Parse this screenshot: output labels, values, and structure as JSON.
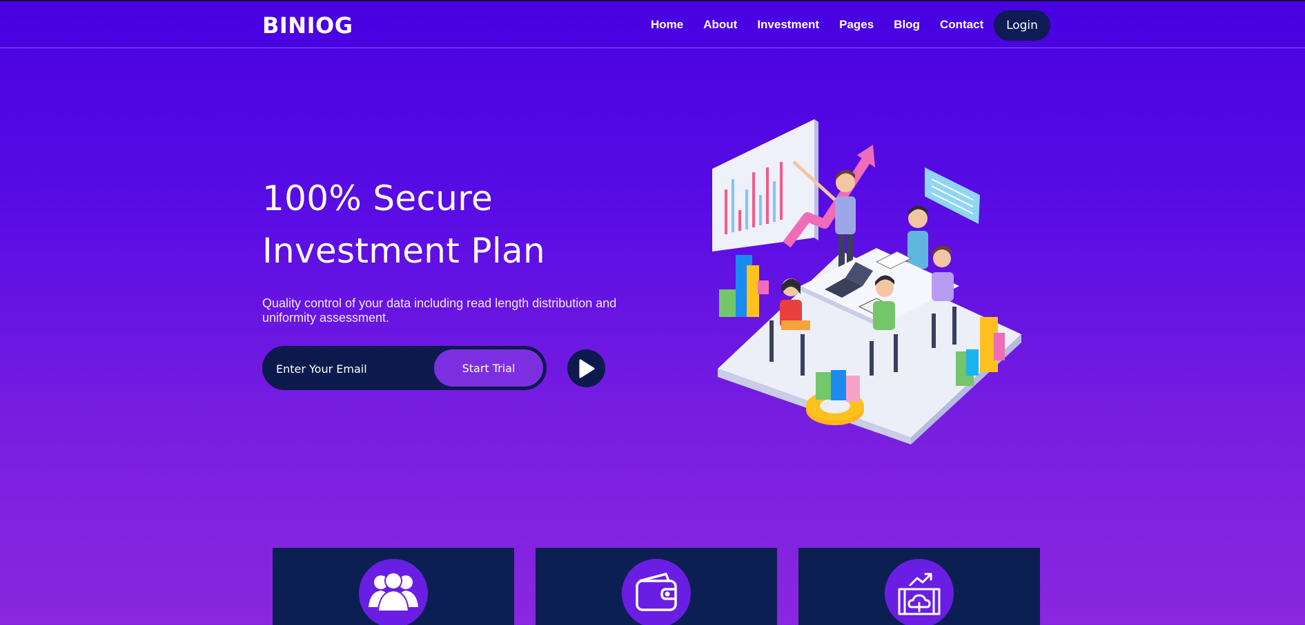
{
  "brand": {
    "logo_text": "BINIOG"
  },
  "nav": {
    "items": [
      {
        "label": "Home"
      },
      {
        "label": "About"
      },
      {
        "label": "Investment"
      },
      {
        "label": "Pages"
      },
      {
        "label": "Blog"
      },
      {
        "label": "Contact"
      }
    ],
    "login_label": "Login"
  },
  "hero": {
    "title_line1": "100% Secure",
    "title_line2": "Investment Plan",
    "subtitle": "Quality control of your data including read length distribution and uniformity assessment.",
    "email_placeholder": "Enter Your Email",
    "cta_label": "Start Trial",
    "play_icon": "play-icon",
    "illustration_icon": "team-meeting-illustration"
  },
  "features": [
    {
      "icon": "users-group-icon"
    },
    {
      "icon": "wallet-icon"
    },
    {
      "icon": "cloud-growth-icon"
    }
  ],
  "colors": {
    "background_top": "#4701e1",
    "background_bottom": "#8a27df",
    "navy": "#0c1a4d",
    "accent_purple": "#7c2fe0"
  }
}
